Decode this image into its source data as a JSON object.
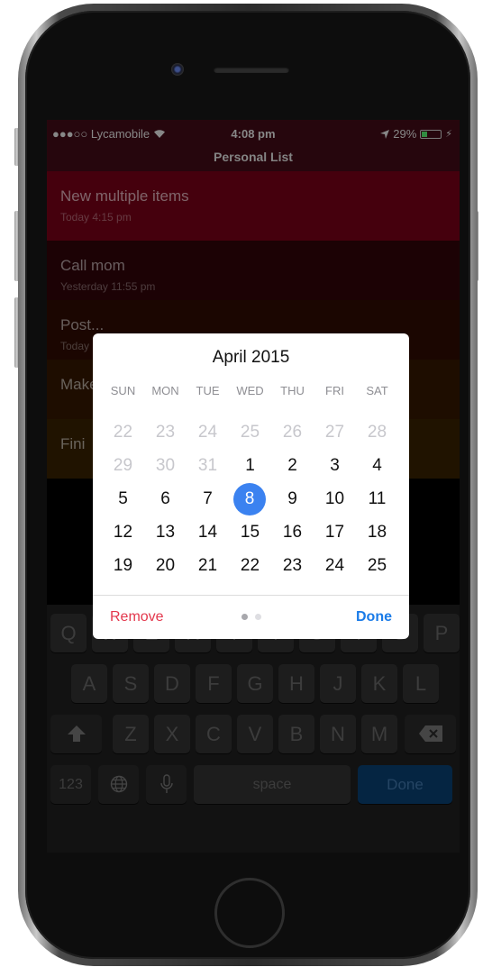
{
  "status_bar": {
    "carrier": "●●●○○ Lycamobile",
    "time": "4:08 pm",
    "battery": "29%",
    "battery_level": 0.29
  },
  "nav": {
    "title": "Personal List"
  },
  "list": {
    "items": [
      {
        "title": "New multiple items",
        "subtitle": "Today 4:15 pm"
      },
      {
        "title": "Call mom",
        "subtitle": "Yesterday 11:55 pm"
      },
      {
        "title": "Post...",
        "subtitle": "Today"
      },
      {
        "title": "Make",
        "subtitle": ""
      },
      {
        "title": "Fini",
        "subtitle": ""
      }
    ]
  },
  "calendar": {
    "month_label": "April 2015",
    "weekdays": [
      "SUN",
      "MON",
      "TUE",
      "WED",
      "THU",
      "FRI",
      "SAT"
    ],
    "weeks": [
      [
        {
          "d": "22",
          "muted": true
        },
        {
          "d": "23",
          "muted": true
        },
        {
          "d": "24",
          "muted": true
        },
        {
          "d": "25",
          "muted": true
        },
        {
          "d": "26",
          "muted": true
        },
        {
          "d": "27",
          "muted": true
        },
        {
          "d": "28",
          "muted": true
        }
      ],
      [
        {
          "d": "29",
          "muted": true
        },
        {
          "d": "30",
          "muted": true
        },
        {
          "d": "31",
          "muted": true
        },
        {
          "d": "1"
        },
        {
          "d": "2"
        },
        {
          "d": "3"
        },
        {
          "d": "4"
        }
      ],
      [
        {
          "d": "5"
        },
        {
          "d": "6"
        },
        {
          "d": "7"
        },
        {
          "d": "8",
          "selected": true
        },
        {
          "d": "9"
        },
        {
          "d": "10"
        },
        {
          "d": "11"
        }
      ],
      [
        {
          "d": "12"
        },
        {
          "d": "13"
        },
        {
          "d": "14"
        },
        {
          "d": "15"
        },
        {
          "d": "16"
        },
        {
          "d": "17"
        },
        {
          "d": "18"
        }
      ],
      [
        {
          "d": "19"
        },
        {
          "d": "20"
        },
        {
          "d": "21"
        },
        {
          "d": "22"
        },
        {
          "d": "23"
        },
        {
          "d": "24"
        },
        {
          "d": "25"
        }
      ]
    ],
    "remove_label": "Remove",
    "done_label": "Done",
    "page_dots": {
      "count": 2,
      "active": 0
    }
  },
  "keyboard": {
    "row1": [
      "Q",
      "W",
      "E",
      "R",
      "T",
      "Y",
      "U",
      "I",
      "O",
      "P"
    ],
    "row2": [
      "A",
      "S",
      "D",
      "F",
      "G",
      "H",
      "J",
      "K",
      "L"
    ],
    "row3": [
      "Z",
      "X",
      "C",
      "V",
      "B",
      "N",
      "M"
    ],
    "numbers_label": "123",
    "space_label": "space",
    "done_label": "Done",
    "shift_icon": "shift-icon",
    "delete_icon": "delete-icon",
    "globe_icon": "globe-icon",
    "mic_icon": "microphone-icon"
  },
  "colors": {
    "accent": "#1a7be8",
    "selected_day": "#3b82f0",
    "remove": "#e3384d",
    "list_rows": [
      "#6a0014",
      "#2c0408",
      "#2a0a02",
      "#2e1500",
      "#321e00"
    ]
  }
}
